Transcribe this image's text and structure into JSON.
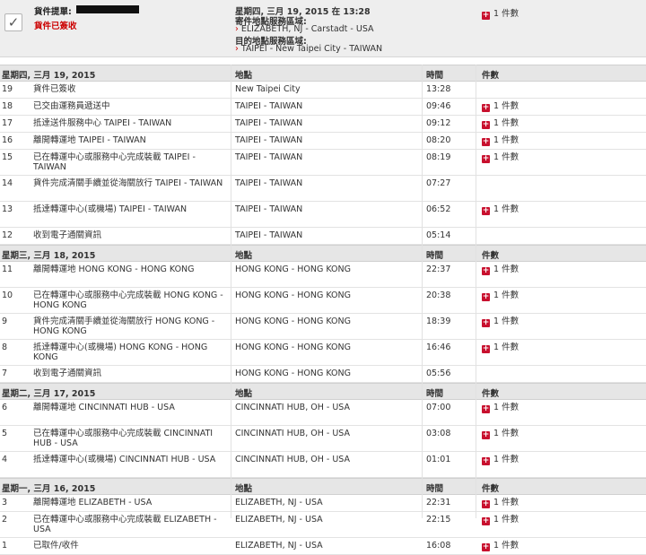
{
  "summary": {
    "waybill_label": "貨件提單:",
    "status": "貨件已簽收",
    "date_line": "星期四, 三月 19, 2015 在 13:28",
    "origin_label": "寄件地點服務區域:",
    "origin_value": "ELIZABETH, NJ - Carstadt - USA",
    "dest_label": "目的地點服務區域:",
    "dest_value": "TAIPEI - New Taipei City - TAIWAN",
    "pieces": "1 件數",
    "check_icon": "checkmark-icon",
    "arrow_glyph": "›",
    "plus_glyph": "+"
  },
  "columns": {
    "location": "地點",
    "time": "時間",
    "pieces": "件數"
  },
  "sections": [
    {
      "date": "星期四, 三月 19, 2015",
      "events": [
        {
          "num": "19",
          "desc": "貨件已簽收",
          "loc": "New Taipei City",
          "time": "13:28",
          "pieces": ""
        },
        {
          "num": "18",
          "desc": "已交由運務員遞送中",
          "loc": "TAIPEI - TAIWAN",
          "time": "09:46",
          "pieces": "1 件數"
        },
        {
          "num": "17",
          "desc": "抵達送件服務中心 TAIPEI - TAIWAN",
          "loc": "TAIPEI - TAIWAN",
          "time": "09:12",
          "pieces": "1 件數"
        },
        {
          "num": "16",
          "desc": "離開轉運地 TAIPEI - TAIWAN",
          "loc": "TAIPEI - TAIWAN",
          "time": "08:20",
          "pieces": "1 件數"
        },
        {
          "num": "15",
          "desc": "已在轉運中心或服務中心完成裝載 TAIPEI - TAIWAN",
          "loc": "TAIPEI - TAIWAN",
          "time": "08:19",
          "pieces": "1 件數"
        },
        {
          "num": "14",
          "desc": "貨件完成清關手續並從海關放行 TAIPEI - TAIWAN",
          "loc": "TAIPEI - TAIWAN",
          "time": "07:27",
          "pieces": ""
        },
        {
          "num": "13",
          "desc": "抵達轉運中心(或機場) TAIPEI - TAIWAN",
          "loc": "TAIPEI - TAIWAN",
          "time": "06:52",
          "pieces": "1 件數"
        },
        {
          "num": "12",
          "desc": "收到電子通關資訊",
          "loc": "TAIPEI - TAIWAN",
          "time": "05:14",
          "pieces": ""
        }
      ]
    },
    {
      "date": "星期三, 三月 18, 2015",
      "events": [
        {
          "num": "11",
          "desc": "離開轉運地 HONG KONG - HONG KONG",
          "loc": "HONG KONG - HONG KONG",
          "time": "22:37",
          "pieces": "1 件數"
        },
        {
          "num": "10",
          "desc": "已在轉運中心或服務中心完成裝載 HONG KONG - HONG KONG",
          "loc": "HONG KONG - HONG KONG",
          "time": "20:38",
          "pieces": "1 件數"
        },
        {
          "num": "9",
          "desc": "貨件完成清關手續並從海關放行 HONG KONG - HONG KONG",
          "loc": "HONG KONG - HONG KONG",
          "time": "18:39",
          "pieces": "1 件數"
        },
        {
          "num": "8",
          "desc": "抵達轉運中心(或機場) HONG KONG - HONG KONG",
          "loc": "HONG KONG - HONG KONG",
          "time": "16:46",
          "pieces": "1 件數"
        },
        {
          "num": "7",
          "desc": "收到電子通關資訊",
          "loc": "HONG KONG - HONG KONG",
          "time": "05:56",
          "pieces": ""
        }
      ]
    },
    {
      "date": "星期二, 三月 17, 2015",
      "events": [
        {
          "num": "6",
          "desc": "離開轉運地 CINCINNATI HUB - USA",
          "loc": "CINCINNATI HUB, OH - USA",
          "time": "07:00",
          "pieces": "1 件數"
        },
        {
          "num": "5",
          "desc": "已在轉運中心或服務中心完成裝載 CINCINNATI HUB - USA",
          "loc": "CINCINNATI HUB, OH - USA",
          "time": "03:08",
          "pieces": "1 件數"
        },
        {
          "num": "4",
          "desc": "抵達轉運中心(或機場) CINCINNATI HUB - USA",
          "loc": "CINCINNATI HUB, OH - USA",
          "time": "01:01",
          "pieces": "1 件數"
        }
      ]
    },
    {
      "date": "星期一, 三月 16, 2015",
      "events": [
        {
          "num": "3",
          "desc": "離開轉運地 ELIZABETH - USA",
          "loc": "ELIZABETH, NJ - USA",
          "time": "22:31",
          "pieces": "1 件數"
        },
        {
          "num": "2",
          "desc": "已在轉運中心或服務中心完成裝載 ELIZABETH - USA",
          "loc": "ELIZABETH, NJ - USA",
          "time": "22:15",
          "pieces": "1 件數"
        },
        {
          "num": "1",
          "desc": "已取件/收件",
          "loc": "ELIZABETH, NJ - USA",
          "time": "16:08",
          "pieces": "1 件數"
        }
      ]
    }
  ]
}
